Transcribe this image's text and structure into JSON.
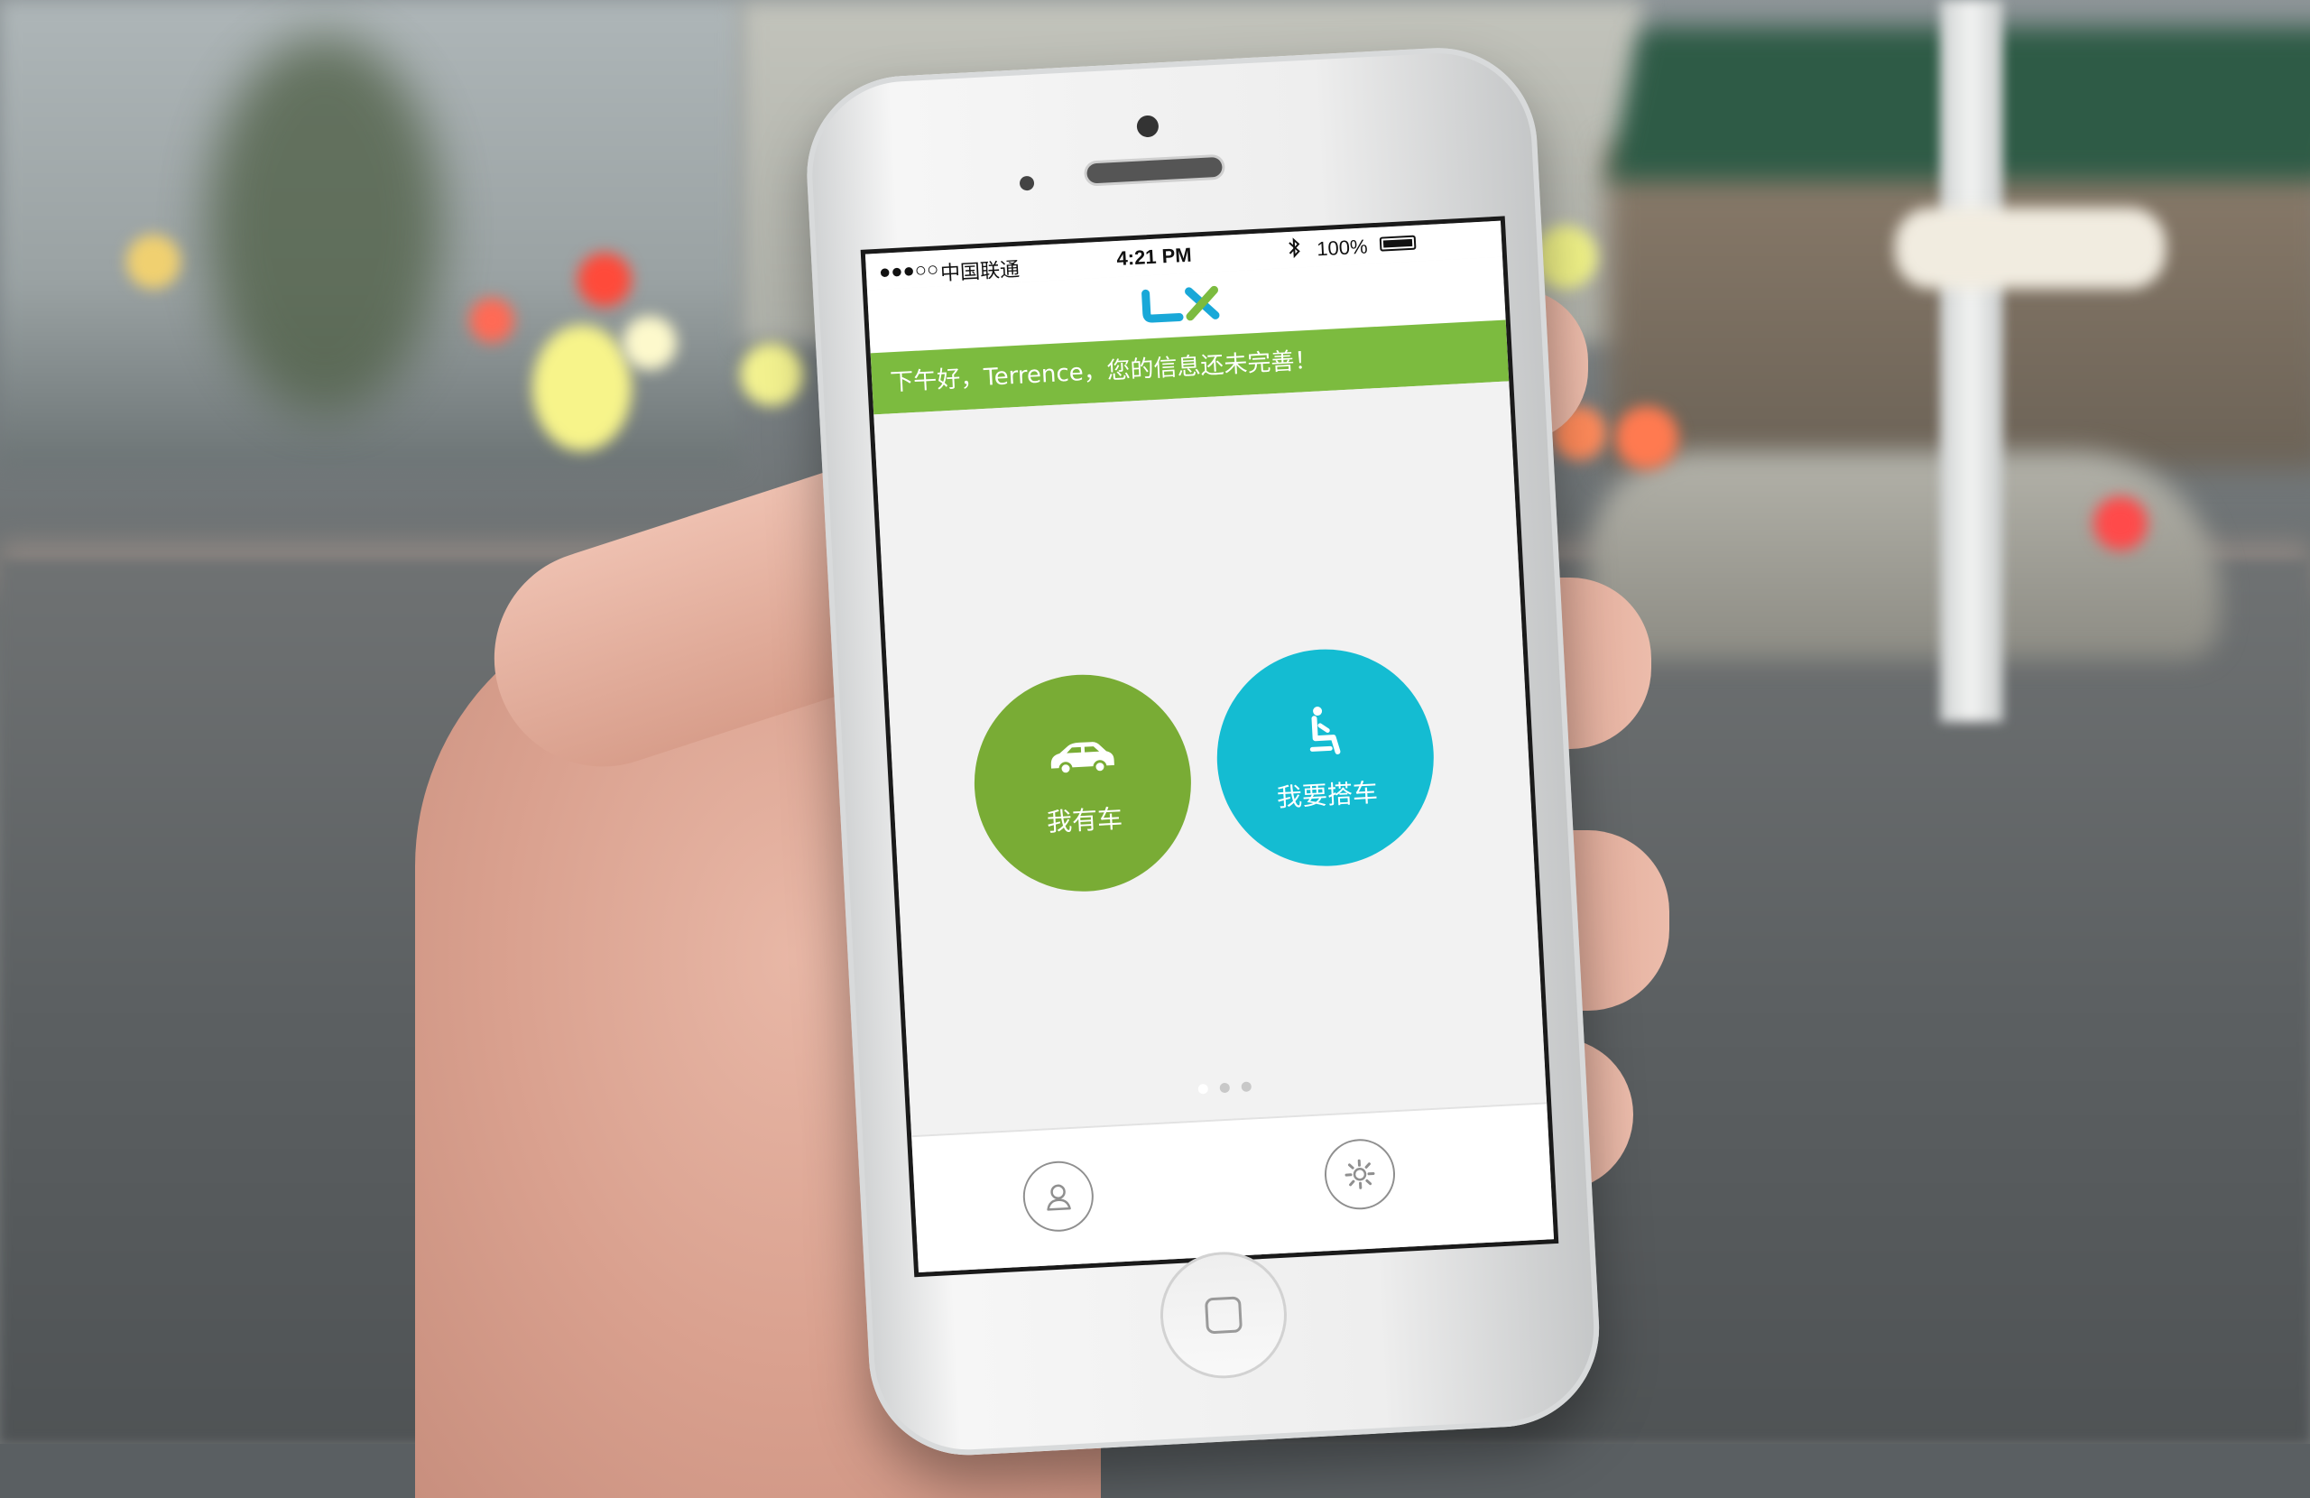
{
  "status_bar": {
    "signal": "●●●○○",
    "carrier": "中国联通",
    "time": "4:21 PM",
    "battery": "100%"
  },
  "header": {
    "logo_text": "LX",
    "greeting": "下午好，Terrence，您的信息还未完善！"
  },
  "actions": {
    "driver_label": "我有车",
    "passenger_label": "我要搭车"
  },
  "pager": {
    "pages": 3,
    "current": 1
  },
  "tabbar": {
    "profile_icon": "user-icon",
    "settings_icon": "gear-icon"
  },
  "colors": {
    "brand_green": "#7cbb3f",
    "driver_green": "#79ac35",
    "passenger_cyan": "#14bcd2",
    "logo_blue": "#19a8d8"
  }
}
